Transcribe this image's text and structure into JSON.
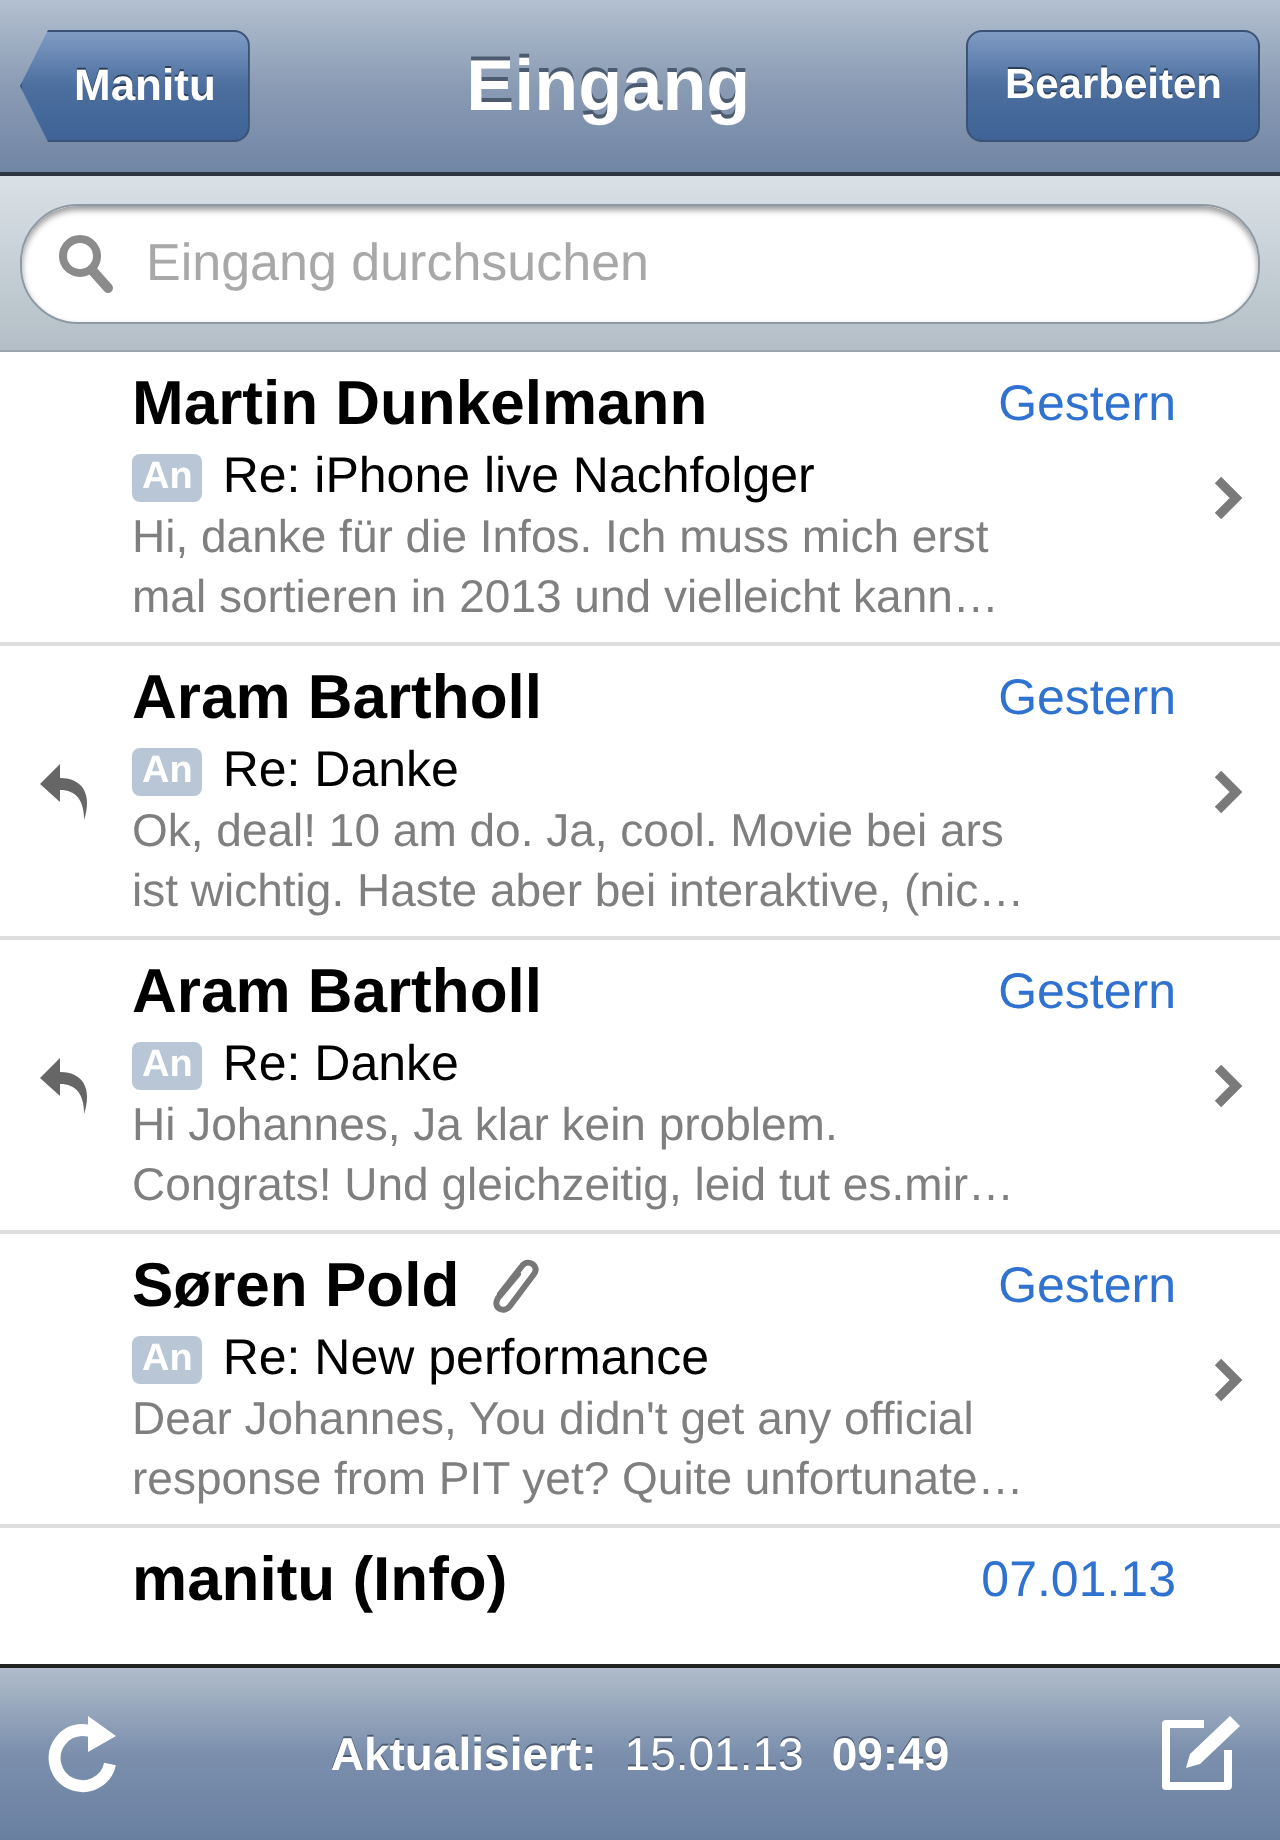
{
  "nav": {
    "back": "Manitu",
    "title": "Eingang",
    "edit": "Bearbeiten"
  },
  "search": {
    "placeholder": "Eingang durchsuchen"
  },
  "messages": [
    {
      "sender": "Martin Dunkelmann",
      "date": "Gestern",
      "badge": "An",
      "subject": "Re: iPhone live Nachfolger",
      "preview_lines": [
        "Hi, danke für die Infos. Ich muss mich erst",
        "mal sortieren in 2013 und vielleicht kann…"
      ],
      "replied": false,
      "attachment": false
    },
    {
      "sender": "Aram Bartholl",
      "date": "Gestern",
      "badge": "An",
      "subject": "Re: Danke",
      "preview_lines": [
        "Ok, deal! 10 am do. Ja, cool. Movie bei ars",
        "ist wichtig. Haste aber bei interaktive, (nic…"
      ],
      "replied": true,
      "attachment": false
    },
    {
      "sender": "Aram Bartholl",
      "date": "Gestern",
      "badge": "An",
      "subject": "Re: Danke",
      "preview_lines": [
        "Hi Johannes, Ja klar kein problem.",
        "Congrats! Und gleichzeitig, leid tut es.mir…"
      ],
      "replied": true,
      "attachment": false
    },
    {
      "sender": "Søren Pold",
      "date": "Gestern",
      "badge": "An",
      "subject": "Re: New performance",
      "preview_lines": [
        "Dear Johannes, You didn't get any official",
        "response from PIT yet? Quite unfortunate…"
      ],
      "replied": false,
      "attachment": true
    }
  ],
  "partial_message": {
    "sender": "manitu (Info)",
    "date": "07.01.13"
  },
  "toolbar": {
    "label": "Aktualisiert:",
    "date": "15.01.13",
    "time": "09:49"
  }
}
